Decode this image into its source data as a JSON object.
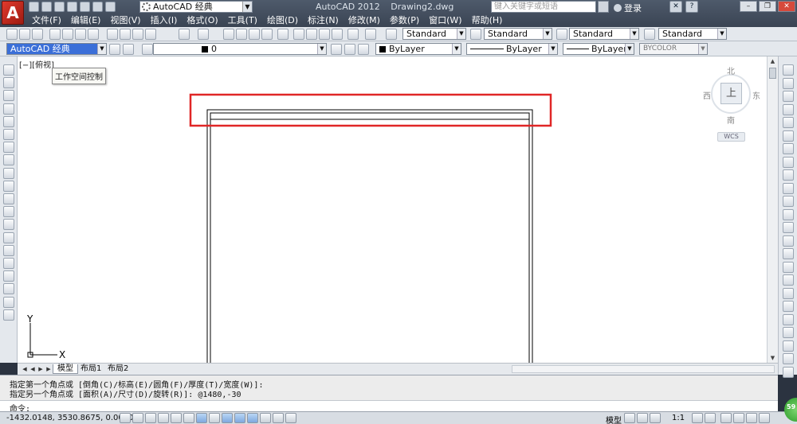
{
  "titlebar": {
    "workspace": "AutoCAD 经典",
    "app_name": "AutoCAD 2012",
    "file_name": "Drawing2.dwg",
    "search_placeholder": "键入关键字或短语",
    "login": "登录"
  },
  "menu": [
    "文件(F)",
    "编辑(E)",
    "视图(V)",
    "插入(I)",
    "格式(O)",
    "工具(T)",
    "绘图(D)",
    "标注(N)",
    "修改(M)",
    "参数(P)",
    "窗口(W)",
    "帮助(H)"
  ],
  "styles_toolbar": {
    "text_style": "Standard",
    "dim_style": "Standard",
    "table_style": "Standard",
    "mleader_style": "Standard"
  },
  "properties_toolbar": {
    "workspace": "AutoCAD 经典",
    "layer": "0",
    "color": "ByLayer",
    "linetype": "ByLayer",
    "lineweight": "ByLayer",
    "plotstyle": "BYCOLOR"
  },
  "viewport": {
    "label": "[−][俯视]",
    "tooltip": "工作空间控制"
  },
  "viewcube": {
    "north": "北",
    "south": "南",
    "east": "东",
    "west": "西",
    "face": "上",
    "wcs": "WCS"
  },
  "ucs": {
    "x": "X",
    "y": "Y"
  },
  "tabs": [
    "模型",
    "布局1",
    "布局2"
  ],
  "command_history": [
    "指定第一个角点或 [倒角(C)/标高(E)/圆角(F)/厚度(T)/宽度(W)]:",
    "指定另一个角点或 [面积(A)/尺寸(D)/旋转(R)]: @1480,-30"
  ],
  "command_prompt": "命令:",
  "status": {
    "coords": "-1432.0148,  3530.8675,  0.0000",
    "model": "模型",
    "scale": "1:1",
    "badge": "59"
  },
  "colors": {
    "highlight_box": "#e02626",
    "drawing_line": "#000000",
    "title_bg": "#3a4453"
  }
}
